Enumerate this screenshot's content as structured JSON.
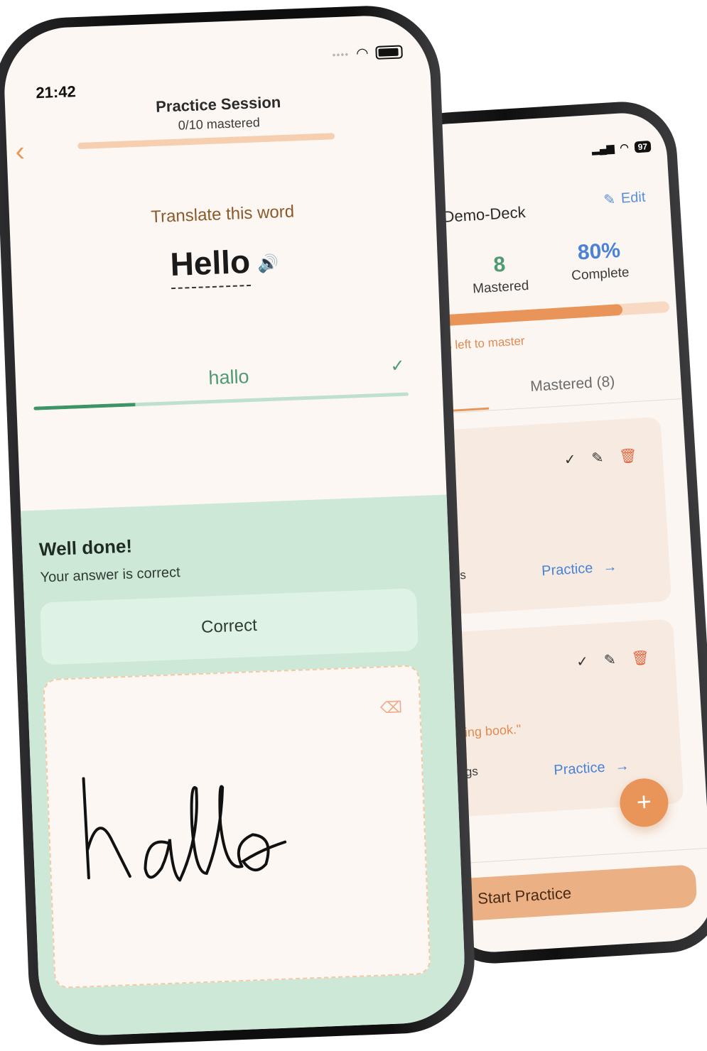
{
  "deck": {
    "status_icons": {
      "signal": "signal-icon",
      "wifi": "wifi-icon",
      "battery": "97"
    },
    "title": "Demo-Deck",
    "edit_label": "Edit",
    "mastered_count": "8",
    "mastered_label": "Mastered",
    "complete_percent": "80%",
    "complete_label": "Complete",
    "progress": 0.8,
    "words_left_text": "ords left to master",
    "tab_mastered": "Mastered (8)",
    "cards": [
      {
        "meta_fragment": "ngs",
        "quote_fragment": "",
        "practice_label": "Practice"
      },
      {
        "meta_fragment": "ngs",
        "quote_fragment": "sting book.\"",
        "extra_fragment": "k.",
        "practice_label": "Practice"
      }
    ],
    "fab_label": "+",
    "start_practice_label": "Start Practice"
  },
  "session": {
    "time": "21:42",
    "title": "Practice Session",
    "subtitle": "0/10 mastered",
    "progress": 0.0,
    "prompt": "Translate this word",
    "word": "Hello",
    "answer": "hallo",
    "answer_progress": 0.27,
    "result_title": "Well done!",
    "result_message": "Your answer is correct",
    "correct_button": "Correct",
    "handwriting": "hallo",
    "colors": {
      "accent": "#e9955a",
      "success": "#4f9a72",
      "panel": "#cde8d7"
    }
  }
}
